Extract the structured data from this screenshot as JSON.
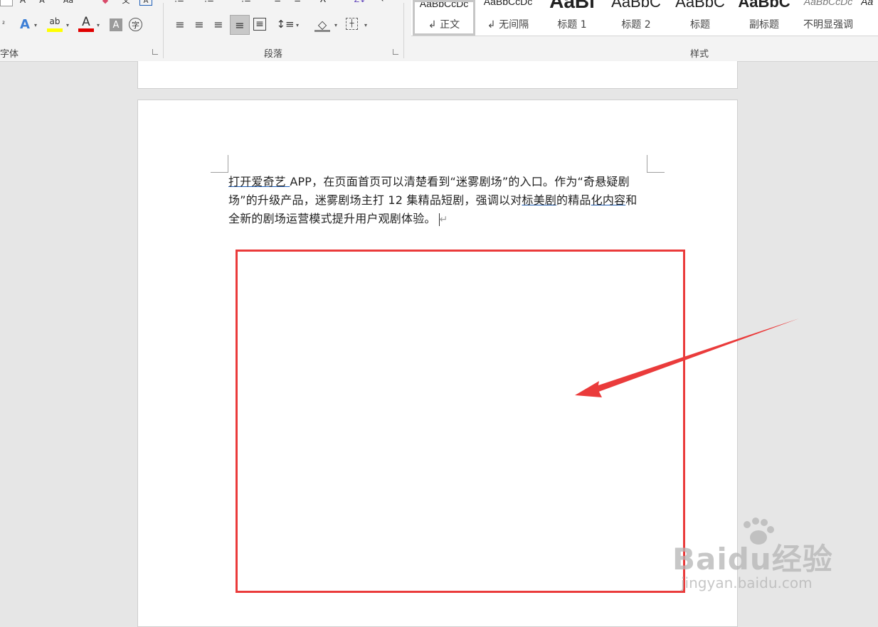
{
  "ribbon": {
    "font_group": {
      "label": "字体",
      "superscript_glyph": "²",
      "text_effects_glyph": "A",
      "highlight_glyph": "ab",
      "font_color_glyph": "A",
      "char_shading_glyph": "A",
      "enclose_glyph": "字"
    },
    "paragraph_group": {
      "label": "段落"
    },
    "styles_group": {
      "label": "样式",
      "tiles": [
        {
          "preview": "AaBbCcDc",
          "name": "↲ 正文",
          "selected": true
        },
        {
          "preview": "AaBbCcDc",
          "name": "↲ 无间隔",
          "selected": false
        },
        {
          "preview": "AaBl",
          "name": "标题 1",
          "selected": false
        },
        {
          "preview": "AaBbC",
          "name": "标题 2",
          "selected": false
        },
        {
          "preview": "AaBbC",
          "name": "标题",
          "selected": false
        },
        {
          "preview": "AaBbC",
          "name": "副标题",
          "selected": false
        },
        {
          "preview": "AaBbCcDc",
          "name": "不明显强调",
          "selected": false
        },
        {
          "preview": "Aa",
          "name": "",
          "selected": false
        }
      ]
    }
  },
  "document": {
    "paragraph": {
      "part1": "打开爱奇艺",
      "part2": " APP，在页面首页可以清楚看到“迷雾剧场”的入口。作为“奇悬疑剧场”的升级产品，迷雾剧场主打 12 集精品短剧，强调以对",
      "part3": "标美剧",
      "part4": "的精品",
      "part5": "化内容",
      "part6": "和全新的剧场运营模式提升用户观剧体验。",
      "para_mark": "↵"
    }
  },
  "annotation": {
    "box_color": "#ea3b3b",
    "arrow_color": "#ea3b3b"
  },
  "watermark": {
    "main": "Baidu经验",
    "sub": "jingyan.baidu.com"
  }
}
